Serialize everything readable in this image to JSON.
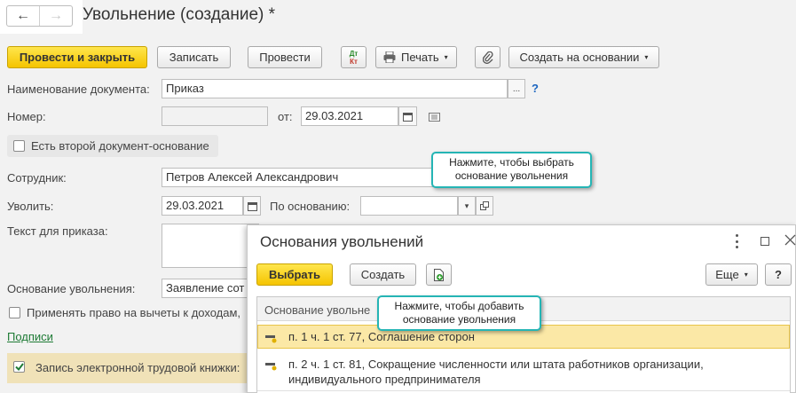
{
  "window": {
    "title": "Увольнение (создание) *",
    "nav": {
      "back": "←",
      "forward": "→"
    }
  },
  "toolbar": {
    "post_close": "Провести и закрыть",
    "save": "Записать",
    "post": "Провести",
    "dt_kt_top": "Дт",
    "dt_kt_bottom": "Кт",
    "print": "Печать",
    "create_based": "Создать на основании"
  },
  "form": {
    "doc_name_label": "Наименование документа:",
    "doc_name_value": "Приказ",
    "doc_name_select": "...",
    "help": "?",
    "number_label": "Номер:",
    "number_value": "",
    "date_from_label": "от:",
    "date_from_value": "29.03.2021",
    "second_doc_label": "Есть второй документ-основание",
    "employee_label": "Сотрудник:",
    "employee_value": "Петров Алексей Александрович",
    "dismiss_label": "Уволить:",
    "dismiss_date": "29.03.2021",
    "basis_label": "По основанию:",
    "basis_value": "",
    "order_text_label": "Текст для приказа:",
    "reason_label": "Основание увольнения:",
    "reason_value": "Заявление сот",
    "deductions_label": "Применять право на вычеты к доходам,",
    "signatures_link": "Подписи",
    "etk_label": "Запись электронной трудовой книжки:"
  },
  "tooltips": {
    "choose": "Нажмите, чтобы выбрать основание увольнения",
    "add": "Нажмите, чтобы добавить основание увольнения"
  },
  "dialog": {
    "title": "Основания увольнений",
    "choose": "Выбрать",
    "create": "Создать",
    "more": "Еще",
    "help": "?",
    "column_header": "Основание увольне",
    "rows": [
      "п. 1 ч. 1 ст. 77, Соглашение сторон",
      "п. 2 ч. 1 ст. 81, Сокращение численности или штата работников организации, индивидуального предпринимателя"
    ]
  },
  "colors": {
    "accent_yellow": "#f5c400",
    "tooltip_border": "#25b5b5",
    "link_green": "#1e7b35",
    "selected_row": "#fbe8a6"
  }
}
